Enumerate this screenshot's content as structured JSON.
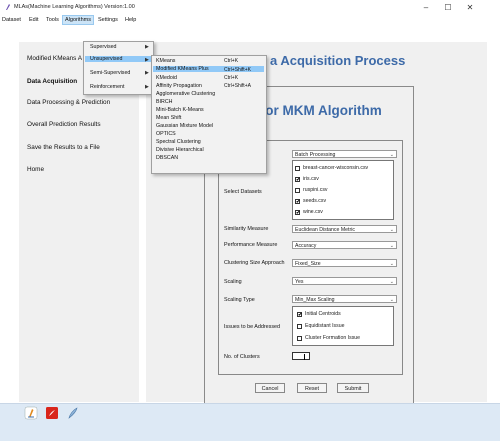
{
  "window": {
    "title": "MLAs(Machine Learning Algorithms) Version:1.00",
    "minimize": "–",
    "maximize": "☐",
    "close": "✕"
  },
  "menubar": [
    "Dataset",
    "Edit",
    "Tools",
    "Algorithms",
    "Settings",
    "Help"
  ],
  "algorithms_menu": [
    "Supervised",
    "Unsupervised",
    "Semi-Supervised",
    "Reinforcement"
  ],
  "unsupervised_menu": [
    {
      "label": "KMeans",
      "shortcut": "Ctrl+K"
    },
    {
      "label": "Modified KMeans Plus",
      "shortcut": "Ctrl+Shift+K"
    },
    {
      "label": "KMedoid",
      "shortcut": "Ctrl+K"
    },
    {
      "label": "Affinity Propagation",
      "shortcut": "Ctrl+Shift+A"
    },
    {
      "label": "Agglomerative Clustering",
      "shortcut": ""
    },
    {
      "label": "BIRCH",
      "shortcut": ""
    },
    {
      "label": "Mini-Batch K-Means",
      "shortcut": ""
    },
    {
      "label": "Mean Shift",
      "shortcut": ""
    },
    {
      "label": "Gaussian Mixture Model",
      "shortcut": ""
    },
    {
      "label": "OPTICS",
      "shortcut": ""
    },
    {
      "label": "Spectral Clustering",
      "shortcut": ""
    },
    {
      "label": "Divisive Hierarchical",
      "shortcut": ""
    },
    {
      "label": "DBSCAN",
      "shortcut": ""
    }
  ],
  "sidebar": {
    "items": [
      "Modified KMeans A",
      "Data Acquisition",
      "Data Processing & Prediction",
      "Overall Prediction Results",
      "Save the Results to a File",
      "Home"
    ]
  },
  "main": {
    "header": "a Acquisition Process"
  },
  "form": {
    "title": "m for MKM Algorithm",
    "mode_value": "Batch Processing",
    "select_datasets_label": "Select Datasets",
    "datasets": [
      {
        "name": "breast-cancer-wisconsin.csv",
        "checked": false
      },
      {
        "name": "iris.csv",
        "checked": true
      },
      {
        "name": "ruspini.csv",
        "checked": false
      },
      {
        "name": "seeds.csv",
        "checked": true
      },
      {
        "name": "wine.csv",
        "checked": true
      }
    ],
    "similarity_label": "Similarity Measure",
    "similarity_value": "Euclidean Distance Metric",
    "performance_label": "Performance Measure",
    "performance_value": "Accuracy",
    "clustering_size_label": "Clustering Size Approach",
    "clustering_size_value": "Fixed_Size",
    "scaling_label": "Scaling",
    "scaling_value": "Yes",
    "scaling_type_label": "Scaling Type",
    "scaling_type_value": "Min_Max Scaling",
    "issues_label": "Issues to be Addressed",
    "issues": [
      {
        "name": "Initial Centroids",
        "checked": true
      },
      {
        "name": "Equidistant Issue",
        "checked": false
      },
      {
        "name": "Cluster Formation Issue",
        "checked": false
      }
    ],
    "clusters_label": "No. of Clusters",
    "clusters_value": "",
    "buttons": {
      "cancel": "Cancel",
      "reset": "Reset",
      "submit": "Submit"
    }
  },
  "check_mark": "✔",
  "arrow_right": "▶",
  "combo_arrow": "⌄",
  "taskbar": {
    "icons": [
      "app-logo-icon",
      "pdf-icon",
      "feather-icon"
    ]
  }
}
